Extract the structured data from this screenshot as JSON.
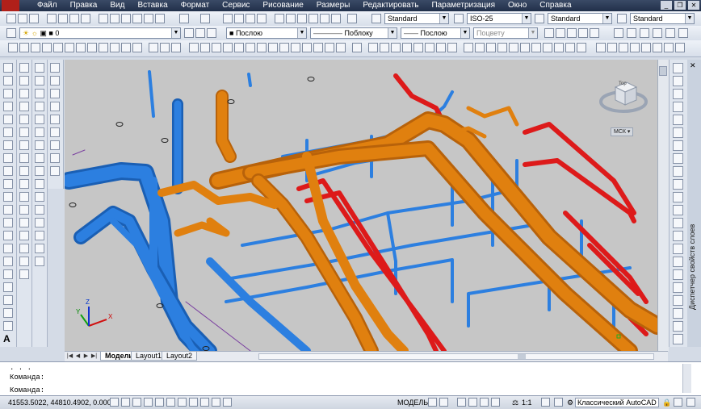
{
  "menu": {
    "items": [
      "Файл",
      "Правка",
      "Вид",
      "Вставка",
      "Формат",
      "Сервис",
      "Рисование",
      "Размеры",
      "Редактировать",
      "Параметризация",
      "Окно",
      "Справка"
    ]
  },
  "toolbar1": {
    "text_style": "Standard",
    "dim_style": "ISO-25",
    "table_style": "Standard",
    "mleader_style": "Standard"
  },
  "toolbar2": {
    "layer": "0",
    "color": "Послою",
    "linetype": "Поблоку",
    "lineweight": "Послою",
    "plotstyle": "Поцвету"
  },
  "viewport": {
    "viewcube_label": "Top",
    "wcs_label": "МСК",
    "axis_x": "X",
    "axis_y": "Y",
    "axis_z": "Z"
  },
  "tabs": [
    "Модель",
    "Layout1",
    "Layout2"
  ],
  "command": {
    "history_dots": ". . .",
    "line1": "Команда:",
    "line2": "Команда:"
  },
  "status": {
    "coords": "41553.5022, 44810.4902, 0.0000",
    "model": "МОДЕЛЬ",
    "scale": "1:1",
    "workspace": "Классический AutoCAD"
  },
  "right_panel": {
    "layer_manager_title": "Диспетчер свойств слоев"
  },
  "colors": {
    "blue_duct": "#2c7fe0",
    "orange_pipe": "#e0800f",
    "red_pipe": "#dd1a1a",
    "background": "#c6c6c6"
  },
  "icons": [
    "new-icon",
    "open-icon",
    "save-icon",
    "print-icon",
    "undo-icon",
    "redo-icon",
    "pan-icon",
    "zoom-icon",
    "layer-icon",
    "properties-icon"
  ]
}
